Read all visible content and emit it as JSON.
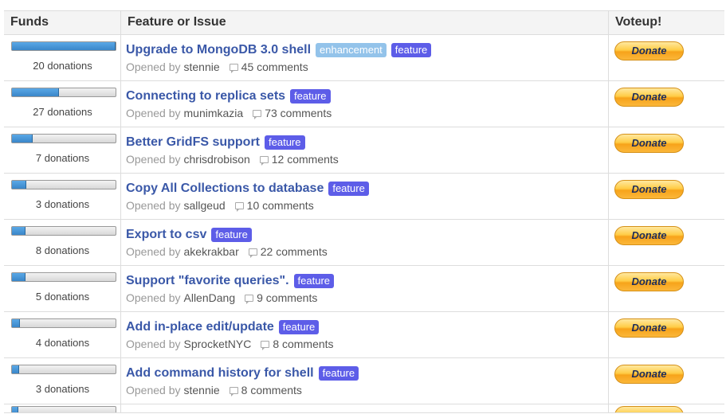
{
  "header": {
    "funds": "Funds",
    "feature": "Feature or Issue",
    "voteup": "Voteup!"
  },
  "opened_by_label": "Opened by",
  "donate_label": "Donate",
  "rows": [
    {
      "progress": 1.0,
      "donations": "20 donations",
      "title": "Upgrade to MongoDB 3.0 shell",
      "tags": [
        "enhancement",
        "feature"
      ],
      "user": "stennie",
      "comments": "45 comments"
    },
    {
      "progress": 0.45,
      "donations": "27 donations",
      "title": "Connecting to replica sets",
      "tags": [
        "feature"
      ],
      "user": "munimkazia",
      "comments": "73 comments"
    },
    {
      "progress": 0.2,
      "donations": "7 donations",
      "title": "Better GridFS support",
      "tags": [
        "feature"
      ],
      "user": "chrisdrobison",
      "comments": "12 comments"
    },
    {
      "progress": 0.14,
      "donations": "3 donations",
      "title": "Copy All Collections to database",
      "tags": [
        "feature"
      ],
      "user": "sallgeud",
      "comments": "10 comments"
    },
    {
      "progress": 0.13,
      "donations": "8 donations",
      "title": "Export to csv",
      "tags": [
        "feature"
      ],
      "user": "akekrakbar",
      "comments": "22 comments"
    },
    {
      "progress": 0.13,
      "donations": "5 donations",
      "title": "Support \"favorite queries\".",
      "tags": [
        "feature"
      ],
      "user": "AllenDang",
      "comments": "9 comments"
    },
    {
      "progress": 0.08,
      "donations": "4 donations",
      "title": "Add in-place edit/update",
      "tags": [
        "feature"
      ],
      "user": "SprocketNYC",
      "comments": "8 comments"
    },
    {
      "progress": 0.07,
      "donations": "3 donations",
      "title": "Add command history for shell",
      "tags": [
        "feature"
      ],
      "user": "stennie",
      "comments": "8 comments"
    }
  ],
  "colors": {
    "feature_badge": "#5d5de8",
    "enhancement_badge": "#93c3ea",
    "title_link": "#3a58a8",
    "progress_fill": "#3a86c8"
  }
}
